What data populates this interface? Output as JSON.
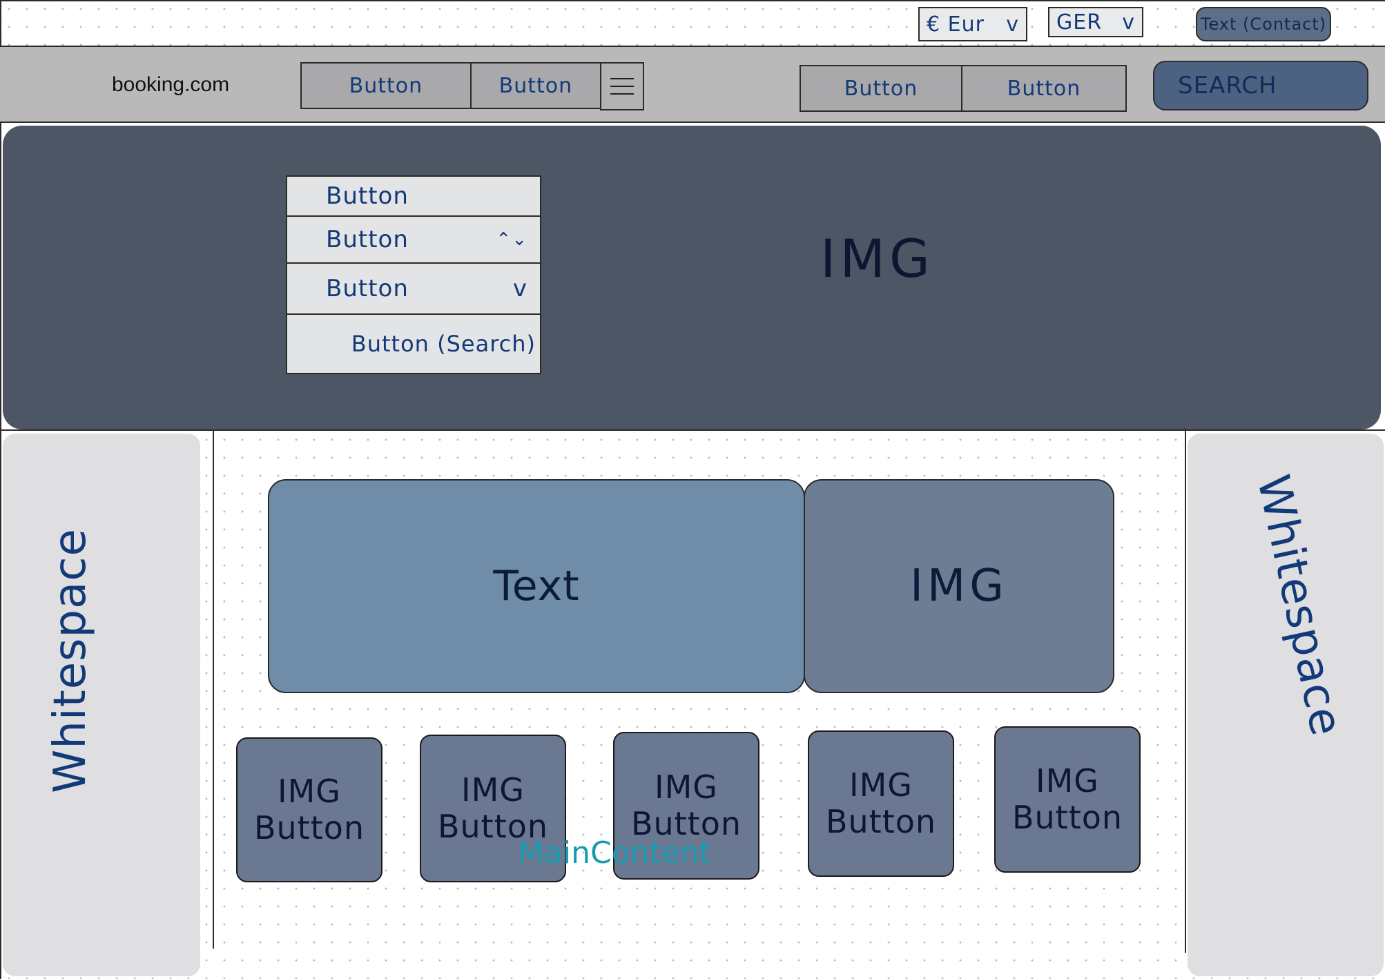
{
  "topbar": {
    "currency": {
      "value": "€ Eur",
      "arrow": "v"
    },
    "language": {
      "value": "GER",
      "arrow": "v"
    },
    "contact_label": "Text (Contact)"
  },
  "navbar": {
    "logo": "booking.com",
    "left_buttons": [
      "Button",
      "Button"
    ],
    "right_buttons": [
      "Button",
      "Button"
    ],
    "search_label": "Search"
  },
  "hero": {
    "image_label": "IMG",
    "search_panel": {
      "rows": [
        {
          "label": "Button",
          "control": ""
        },
        {
          "label": "Button",
          "control": "⌃⌄"
        },
        {
          "label": "Button",
          "control": "v"
        },
        {
          "label": "Button (Search)",
          "control": ""
        }
      ]
    }
  },
  "whitespace": {
    "left_label": "Whitespace",
    "right_label": "Whitespace"
  },
  "main": {
    "caption": "MainContent",
    "promo": {
      "text_label": "Text",
      "image_label": "IMG"
    },
    "cards": [
      {
        "img": "IMG",
        "btn": "Button"
      },
      {
        "img": "IMG",
        "btn": "Button"
      },
      {
        "img": "IMG",
        "btn": "Button"
      },
      {
        "img": "IMG",
        "btn": "Button"
      },
      {
        "img": "IMG",
        "btn": "Button"
      }
    ]
  }
}
